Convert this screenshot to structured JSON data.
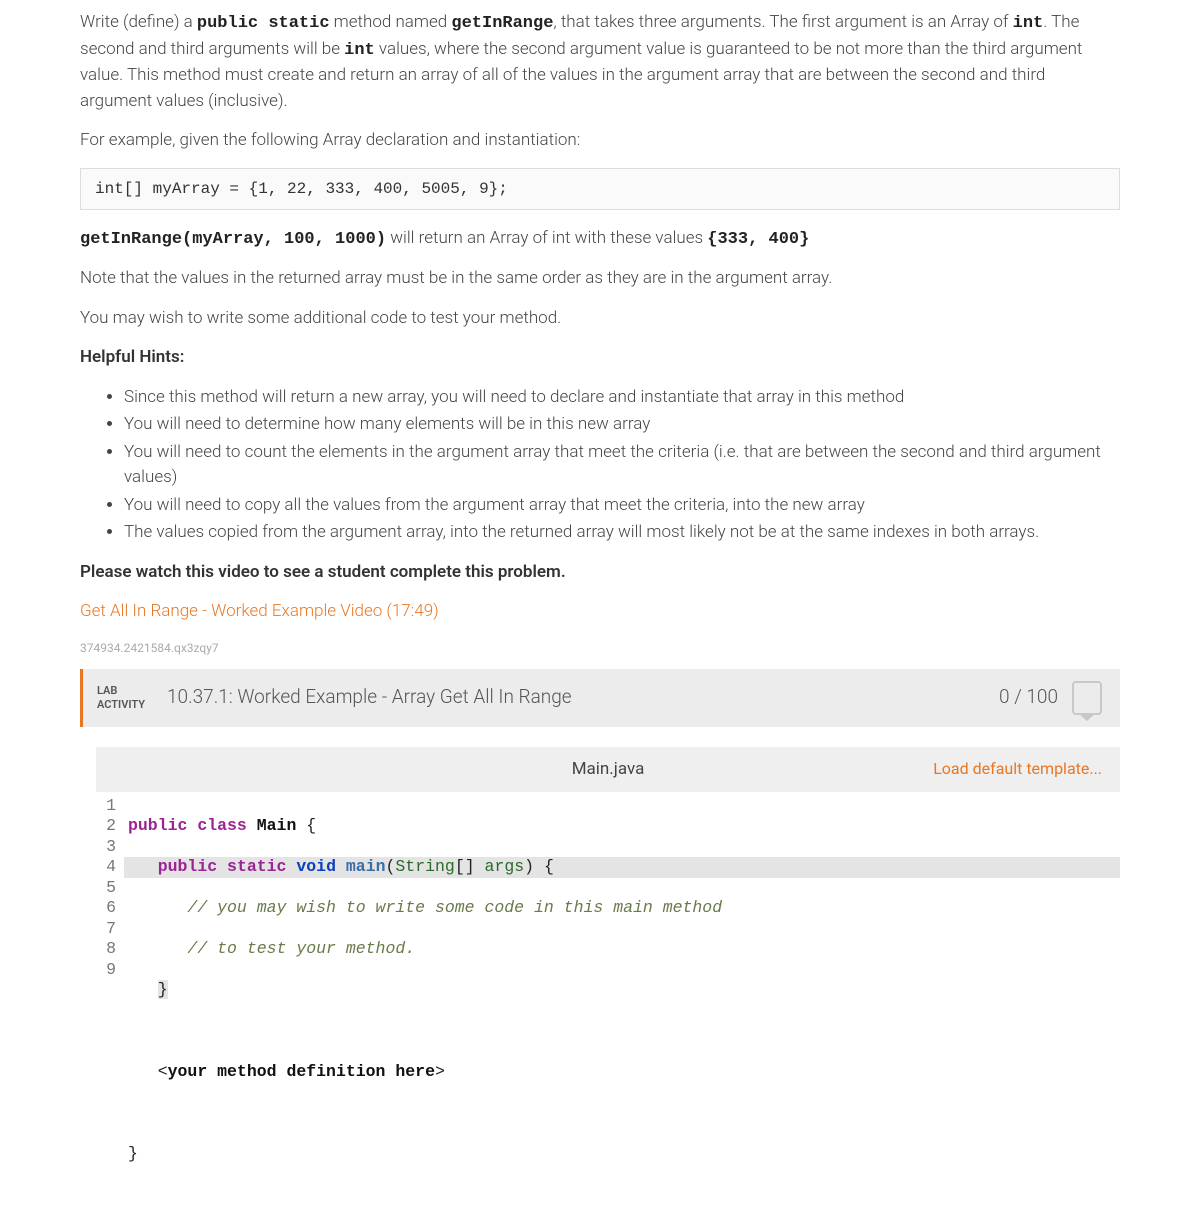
{
  "problem": {
    "p1_prefix": "Write (define) a ",
    "p1_kw1": "public static",
    "p1_mid1": " method named ",
    "p1_kw2": "getInRange",
    "p1_mid2": ", that takes three arguments. The first argument is an Array of ",
    "p1_kw3": "int",
    "p1_mid3": ". The second and third arguments will be ",
    "p1_kw4": "int",
    "p1_suffix": " values, where the second argument value is guaranteed to be not more than the third argument value. This method must create and return an array of all of the values in the argument array that are between the second and third argument values (inclusive).",
    "p2": "For example, given the following Array declaration and instantiation:",
    "codeblock": "int[] myArray = {1, 22, 333, 400, 5005, 9};",
    "p3_kw": "getInRange(myArray, 100, 1000)",
    "p3_mid": " will return an Array of int with these values ",
    "p3_res": "{333, 400}",
    "p4": "Note that the values in the returned array must be in the same order as they are in the argument array.",
    "p5": "You may wish to write some additional code to test your method.",
    "hints_label": "Helpful Hints:",
    "hints": [
      "Since this method will return a new array, you will need to declare and instantiate that array in this method",
      "You will need to determine how many elements will be in this new array",
      "You will need to count the elements in the argument array that meet the criteria (i.e. that are between the second and third argument values)",
      "You will need to copy all the values from the argument array that meet the criteria, into the new array",
      "The values copied from the argument array, into the returned array will most likely not be at the same indexes in both arrays."
    ],
    "video_prompt": "Please watch this video to see a student complete this problem.",
    "video_link": "Get All In Range - Worked Example Video (17:49)",
    "hash": "374934.2421584.qx3zqy7"
  },
  "lab": {
    "label_line1": "LAB",
    "label_line2": "ACTIVITY",
    "title": "10.37.1: Worked Example - Array Get All In Range",
    "score": "0 / 100"
  },
  "ide": {
    "filename": "Main.java",
    "load_template": "Load default template...",
    "gutter": [
      "1",
      "2",
      "3",
      "4",
      "5",
      "6",
      "7",
      "8",
      "9"
    ],
    "code": {
      "l1": {
        "kw1": "public",
        "kw2": "class",
        "cls": "Main",
        "brace": " {"
      },
      "l2": {
        "indent": "   ",
        "kw1": "public",
        "kw2": "static",
        "kw3": "void",
        "fn": "main",
        "open": "(",
        "type": "String",
        "arr": "[] ",
        "arg": "args",
        "close": ") ",
        "brace": "{"
      },
      "l3": {
        "indent": "      ",
        "text": "// you may wish to write some code in this main method"
      },
      "l4": {
        "indent": "      ",
        "text": "// to test your method."
      },
      "l5": {
        "indent": "   ",
        "brace": "}"
      },
      "l6": "",
      "l7": {
        "indent": "   ",
        "lt": "<",
        "text": "your method definition here",
        "gt": ">"
      },
      "l8": "",
      "l9": {
        "brace": "}"
      }
    }
  }
}
